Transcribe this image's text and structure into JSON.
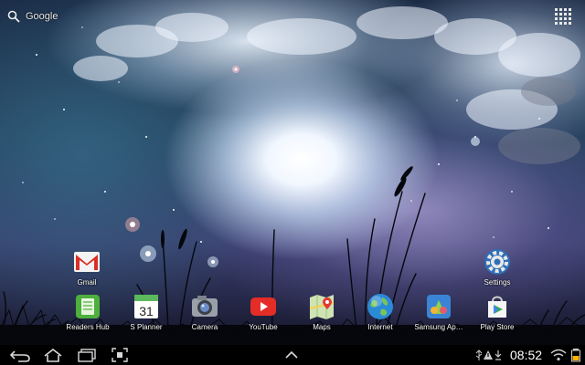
{
  "search_bar": {
    "label": "Google",
    "icon": "search-icon"
  },
  "apps_button": {
    "icon": "apps-grid-icon"
  },
  "widgets": [
    {
      "id": "gmail",
      "label": "Gmail",
      "icon": "gmail-icon"
    },
    {
      "id": "settings",
      "label": "Settings",
      "icon": "settings-gear-icon"
    }
  ],
  "dock": [
    {
      "id": "readers-hub",
      "label": "Readers Hub",
      "icon": "readers-hub-icon"
    },
    {
      "id": "s-planner",
      "label": "S Planner",
      "icon": "calendar-icon",
      "date": "31"
    },
    {
      "id": "camera",
      "label": "Camera",
      "icon": "camera-icon"
    },
    {
      "id": "youtube",
      "label": "YouTube",
      "icon": "youtube-icon"
    },
    {
      "id": "maps",
      "label": "Maps",
      "icon": "maps-icon"
    },
    {
      "id": "internet",
      "label": "Internet",
      "icon": "globe-icon"
    },
    {
      "id": "samsung-apps",
      "label": "Samsung Ap…",
      "icon": "samsung-apps-icon"
    },
    {
      "id": "play-store",
      "label": "Play Store",
      "icon": "play-store-icon"
    }
  ],
  "navigation_bar": {
    "buttons": [
      "back-icon",
      "home-icon",
      "recent-apps-icon",
      "screenshot-icon",
      "up-chevron-icon"
    ],
    "status_icons": [
      "usb-icon",
      "warning-icon",
      "download-icon",
      "wifi-icon",
      "battery-icon"
    ],
    "time": "08:52"
  }
}
